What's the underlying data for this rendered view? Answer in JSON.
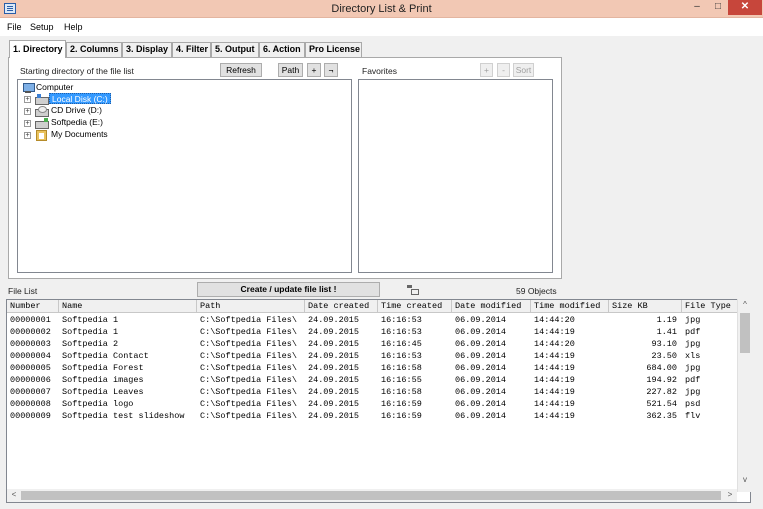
{
  "window": {
    "title": "Directory List & Print",
    "min": "–",
    "max": "□",
    "close": "✕"
  },
  "menu": {
    "file": "File",
    "setup": "Setup",
    "help": "Help"
  },
  "tabs": [
    "1. Directory",
    "2. Columns",
    "3. Display",
    "4. Filter",
    "5. Output",
    "6. Action",
    "Pro License"
  ],
  "directory": {
    "start_label": "Starting directory of the file list",
    "refresh": "Refresh",
    "path": "Path",
    "plus": "+",
    "not": "¬",
    "favorites_label": "Favorites",
    "fav_add": "+",
    "fav_remove": "-",
    "fav_sort": "Sort",
    "tree": {
      "root": "Computer",
      "items": [
        "Local Disk (C:)",
        "CD Drive (D:)",
        "Softpedia (E:)",
        "My Documents"
      ],
      "expanders": [
        "+",
        "+",
        "+",
        "+"
      ]
    }
  },
  "filelist": {
    "label": "File List",
    "create_button": "Create / update file list !",
    "objects": "59 Objects",
    "columns": [
      "Number",
      "Name",
      "Path",
      "Date created",
      "Time created",
      "Date modified",
      "Time modified",
      "Size KB",
      "File Type"
    ],
    "rows": [
      [
        "00000001",
        "Softpedia 1",
        "C:\\Softpedia Files\\",
        "24.09.2015",
        "16:16:53",
        "06.09.2014",
        "14:44:20",
        "1.19",
        "jpg"
      ],
      [
        "00000002",
        "Softpedia 1",
        "C:\\Softpedia Files\\",
        "24.09.2015",
        "16:16:53",
        "06.09.2014",
        "14:44:19",
        "1.41",
        "pdf"
      ],
      [
        "00000003",
        "Softpedia 2",
        "C:\\Softpedia Files\\",
        "24.09.2015",
        "16:16:45",
        "06.09.2014",
        "14:44:20",
        "93.10",
        "jpg"
      ],
      [
        "00000004",
        "Softpedia Contact",
        "C:\\Softpedia Files\\",
        "24.09.2015",
        "16:16:53",
        "06.09.2014",
        "14:44:19",
        "23.50",
        "xls"
      ],
      [
        "00000005",
        "Softpedia Forest",
        "C:\\Softpedia Files\\",
        "24.09.2015",
        "16:16:58",
        "06.09.2014",
        "14:44:19",
        "684.00",
        "jpg"
      ],
      [
        "00000006",
        "Softpedia images",
        "C:\\Softpedia Files\\",
        "24.09.2015",
        "16:16:55",
        "06.09.2014",
        "14:44:19",
        "194.92",
        "pdf"
      ],
      [
        "00000007",
        "Softpedia Leaves",
        "C:\\Softpedia Files\\",
        "24.09.2015",
        "16:16:58",
        "06.09.2014",
        "14:44:19",
        "227.82",
        "jpg"
      ],
      [
        "00000008",
        "Softpedia logo",
        "C:\\Softpedia Files\\",
        "24.09.2015",
        "16:16:59",
        "06.09.2014",
        "14:44:19",
        "521.54",
        "psd"
      ],
      [
        "00000009",
        "Softpedia test slideshow",
        "C:\\Softpedia Files\\",
        "24.09.2015",
        "16:16:59",
        "06.09.2014",
        "14:44:19",
        "362.35",
        "flv"
      ]
    ]
  },
  "scroll": {
    "up": "^",
    "down": "v",
    "left": "<",
    "right": ">"
  }
}
